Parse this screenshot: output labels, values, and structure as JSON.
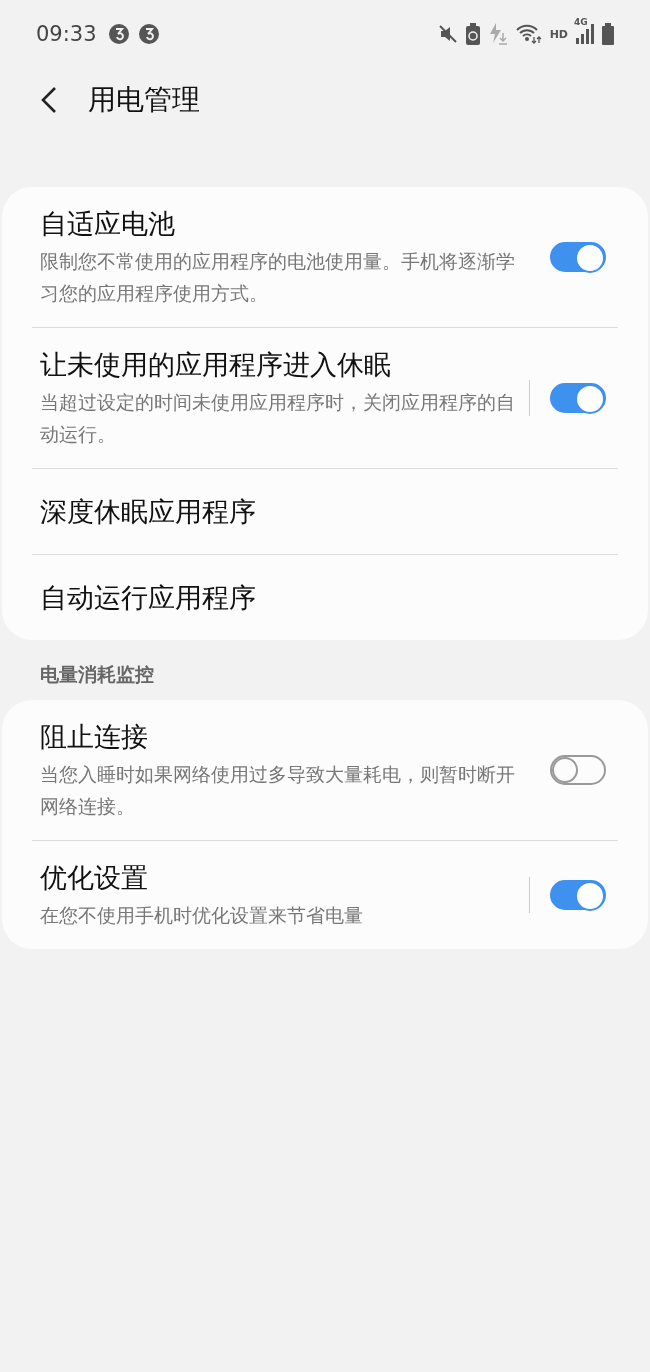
{
  "status_bar": {
    "time": "09:33",
    "hd": "HD",
    "network": "4G"
  },
  "header": {
    "title": "用电管理"
  },
  "groups": [
    {
      "items": [
        {
          "kind": "switch",
          "title": "自适应电池",
          "description": "限制您不常使用的应用程序的电池使用量。手机将逐渐学习您的应用程序使用方式。",
          "on": true,
          "separator": false
        },
        {
          "kind": "switch",
          "title": "让未使用的应用程序进入休眠",
          "description": "当超过设定的时间未使用应用程序时，关闭应用程序的自动运行。",
          "on": true,
          "separator": true
        },
        {
          "kind": "link",
          "title": "深度休眠应用程序"
        },
        {
          "kind": "link",
          "title": "自动运行应用程序"
        }
      ]
    },
    {
      "heading": "电量消耗监控",
      "items": [
        {
          "kind": "switch",
          "title": "阻止连接",
          "description": "当您入睡时如果网络使用过多导致大量耗电，则暂时断开网络连接。",
          "on": false,
          "separator": false
        },
        {
          "kind": "switch",
          "title": "优化设置",
          "description": "在您不使用手机时优化设置来节省电量",
          "on": true,
          "separator": true
        }
      ]
    }
  ]
}
